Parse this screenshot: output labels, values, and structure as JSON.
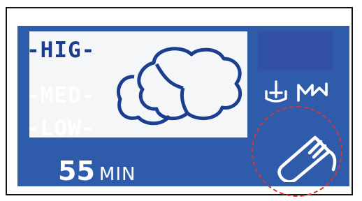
{
  "display": {
    "levels": [
      {
        "label": "-HIG-",
        "selected": true
      },
      {
        "label": "-MED-",
        "selected": false
      },
      {
        "label": "-LOW-",
        "selected": false
      }
    ],
    "timer": {
      "value": "55",
      "unit": "MIN"
    },
    "icons": {
      "laundry": "laundry-load-icon",
      "tub": "tub-water-icon",
      "wave": "wave-mode-icon",
      "tube": "test-tube-icon"
    },
    "colors": {
      "screen_blue": "#2f5bab",
      "panel_dark_blue": "#3150a6",
      "outline_blue": "#1b3f8e",
      "highlight_white": "#f4f6f8",
      "marker_red": "#d83434"
    }
  }
}
